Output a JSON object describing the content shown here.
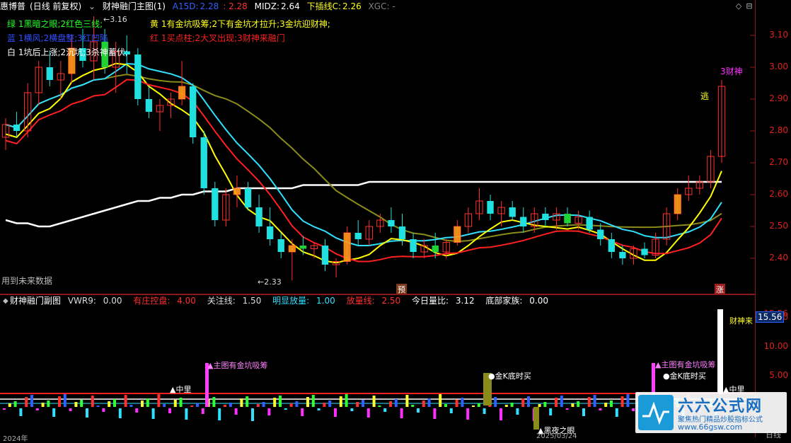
{
  "header": {
    "stock_name": "惠博普",
    "period_mode": "(日线 前复权)",
    "indicator_name": "财神融门主图(1)",
    "a15d_label": "A15D:",
    "a15d_value": "2.28",
    "a15d_value2": ": 2.28",
    "midz_label": "MIDZ:",
    "midz_value": "2.64",
    "xiachaxian_label": "下插线C:",
    "xiachaxian_value": "2.26",
    "xgc_label": "XGC: -"
  },
  "legend": {
    "green": "绿 1黑暗之眼;2红色三线;",
    "yellow": "黄 1有金坑吸筹;2下有金坑才拉升;3金坑迎财神;",
    "blue": "蓝 1横风;2横盘整;3红凹陷",
    "red": "红 1买点柱;2大叉出现;3财神来融门",
    "white": "白 1坑后上涨;2沉坑;3杀神蓄伏;"
  },
  "footer_note": "用到未来数据",
  "annotations": {
    "high_label": "3.16",
    "low_label": "2.33",
    "caishen3": "3财神",
    "tao": "逃",
    "zhang": "涨",
    "yu": "预"
  },
  "sub_header": {
    "name": "财神融门副图",
    "vvr9_label": "VWR9:",
    "vvr9_value": "0.00",
    "youzhuang_label": "有庄控盘:",
    "youzhuang_value": "4.00",
    "guanzhu_label": "关注线:",
    "guanzhu_value": "1.50",
    "mingxian_label": "明显放量:",
    "mingxian_value": "1.00",
    "fangliang_label": "放量线:",
    "fangliang_value": "2.50",
    "jinri_label": "今日量比:",
    "jinri_value": "3.12",
    "dibu_label": "底部家族:",
    "dibu_value": "0.00"
  },
  "sub_annotations": {
    "zhongli1": "中里",
    "zhutu1": "主图有金坑吸筹",
    "jink1": "金K底时买",
    "heiye": "黑夜之眼",
    "zhutu2": "主图有金坑吸筹",
    "jink2": "金K底时买",
    "zhongli2": "中里",
    "caishenlai": "财神来",
    "date_partial": "2025/03/24",
    "bottom_left": "2024年"
  },
  "axis": {
    "main_ticks": [
      "3.10",
      "3.00",
      "2.90",
      "2.80",
      "2.70",
      "2.60",
      "2.50",
      "2.40"
    ],
    "sub_ticks": [
      "15.56",
      "15.00",
      "10.00",
      "5.00"
    ],
    "bottom_label": "日线"
  },
  "logo": {
    "title": "六六公式网",
    "subtitle": "聚焦热门精品炒股指标公式",
    "url": "www.66gsw.com"
  },
  "colors": {
    "up": "#ff3030",
    "down": "#20e0e0",
    "ma_white": "#ffffff",
    "ma_yellow": "#ffff00",
    "ma_olive": "#8b8b1a",
    "ma_cyan": "#30e0ff",
    "ma_red": "#ff2020",
    "band_orange": "#ff9a1a",
    "band_green": "#20d020"
  },
  "chart_data": {
    "type": "candlestick",
    "y_range": [
      2.33,
      3.16
    ],
    "candles": [
      {
        "o": 2.78,
        "h": 2.84,
        "l": 2.74,
        "c": 2.82
      },
      {
        "o": 2.82,
        "h": 2.86,
        "l": 2.78,
        "c": 2.8
      },
      {
        "o": 2.8,
        "h": 2.95,
        "l": 2.78,
        "c": 2.92
      },
      {
        "o": 2.92,
        "h": 3.02,
        "l": 2.88,
        "c": 3.0
      },
      {
        "o": 3.0,
        "h": 3.05,
        "l": 2.94,
        "c": 2.96
      },
      {
        "o": 2.96,
        "h": 3.02,
        "l": 2.9,
        "c": 2.98
      },
      {
        "o": 2.98,
        "h": 3.1,
        "l": 2.95,
        "c": 3.06
      },
      {
        "o": 3.06,
        "h": 3.12,
        "l": 3.0,
        "c": 3.02
      },
      {
        "o": 3.02,
        "h": 3.16,
        "l": 2.96,
        "c": 3.08
      },
      {
        "o": 3.08,
        "h": 3.12,
        "l": 2.98,
        "c": 3.0
      },
      {
        "o": 3.0,
        "h": 3.08,
        "l": 2.92,
        "c": 3.05
      },
      {
        "o": 3.05,
        "h": 3.1,
        "l": 2.98,
        "c": 3.04
      },
      {
        "o": 3.04,
        "h": 3.06,
        "l": 2.88,
        "c": 2.9
      },
      {
        "o": 2.9,
        "h": 2.94,
        "l": 2.84,
        "c": 2.86
      },
      {
        "o": 2.86,
        "h": 2.9,
        "l": 2.8,
        "c": 2.88
      },
      {
        "o": 2.88,
        "h": 2.92,
        "l": 2.84,
        "c": 2.9
      },
      {
        "o": 2.9,
        "h": 3.02,
        "l": 2.88,
        "c": 2.94
      },
      {
        "o": 2.94,
        "h": 2.95,
        "l": 2.76,
        "c": 2.78
      },
      {
        "o": 2.78,
        "h": 2.8,
        "l": 2.6,
        "c": 2.62
      },
      {
        "o": 2.62,
        "h": 2.64,
        "l": 2.5,
        "c": 2.52
      },
      {
        "o": 2.52,
        "h": 2.62,
        "l": 2.5,
        "c": 2.6
      },
      {
        "o": 2.6,
        "h": 2.66,
        "l": 2.56,
        "c": 2.62
      },
      {
        "o": 2.62,
        "h": 2.64,
        "l": 2.55,
        "c": 2.56
      },
      {
        "o": 2.56,
        "h": 2.6,
        "l": 2.48,
        "c": 2.5
      },
      {
        "o": 2.5,
        "h": 2.56,
        "l": 2.44,
        "c": 2.46
      },
      {
        "o": 2.46,
        "h": 2.48,
        "l": 2.4,
        "c": 2.42
      },
      {
        "o": 2.42,
        "h": 2.46,
        "l": 2.33,
        "c": 2.44
      },
      {
        "o": 2.44,
        "h": 2.47,
        "l": 2.41,
        "c": 2.43
      },
      {
        "o": 2.43,
        "h": 2.45,
        "l": 2.4,
        "c": 2.44
      },
      {
        "o": 2.44,
        "h": 2.46,
        "l": 2.36,
        "c": 2.38
      },
      {
        "o": 2.38,
        "h": 2.4,
        "l": 2.34,
        "c": 2.39
      },
      {
        "o": 2.39,
        "h": 2.5,
        "l": 2.38,
        "c": 2.48
      },
      {
        "o": 2.48,
        "h": 2.52,
        "l": 2.44,
        "c": 2.46
      },
      {
        "o": 2.46,
        "h": 2.52,
        "l": 2.44,
        "c": 2.5
      },
      {
        "o": 2.5,
        "h": 2.54,
        "l": 2.48,
        "c": 2.52
      },
      {
        "o": 2.52,
        "h": 2.56,
        "l": 2.48,
        "c": 2.5
      },
      {
        "o": 2.5,
        "h": 2.54,
        "l": 2.44,
        "c": 2.46
      },
      {
        "o": 2.46,
        "h": 2.48,
        "l": 2.4,
        "c": 2.42
      },
      {
        "o": 2.42,
        "h": 2.46,
        "l": 2.4,
        "c": 2.44
      },
      {
        "o": 2.44,
        "h": 2.48,
        "l": 2.4,
        "c": 2.42
      },
      {
        "o": 2.42,
        "h": 2.46,
        "l": 2.4,
        "c": 2.45
      },
      {
        "o": 2.45,
        "h": 2.52,
        "l": 2.44,
        "c": 2.5
      },
      {
        "o": 2.5,
        "h": 2.56,
        "l": 2.48,
        "c": 2.54
      },
      {
        "o": 2.54,
        "h": 2.62,
        "l": 2.52,
        "c": 2.58
      },
      {
        "o": 2.58,
        "h": 2.6,
        "l": 2.52,
        "c": 2.54
      },
      {
        "o": 2.54,
        "h": 2.58,
        "l": 2.5,
        "c": 2.56
      },
      {
        "o": 2.56,
        "h": 2.58,
        "l": 2.52,
        "c": 2.53
      },
      {
        "o": 2.53,
        "h": 2.56,
        "l": 2.48,
        "c": 2.5
      },
      {
        "o": 2.5,
        "h": 2.56,
        "l": 2.48,
        "c": 2.54
      },
      {
        "o": 2.54,
        "h": 2.56,
        "l": 2.5,
        "c": 2.52
      },
      {
        "o": 2.52,
        "h": 2.56,
        "l": 2.49,
        "c": 2.54
      },
      {
        "o": 2.54,
        "h": 2.56,
        "l": 2.5,
        "c": 2.51
      },
      {
        "o": 2.51,
        "h": 2.55,
        "l": 2.49,
        "c": 2.53
      },
      {
        "o": 2.53,
        "h": 2.55,
        "l": 2.48,
        "c": 2.49
      },
      {
        "o": 2.49,
        "h": 2.51,
        "l": 2.44,
        "c": 2.46
      },
      {
        "o": 2.46,
        "h": 2.48,
        "l": 2.4,
        "c": 2.42
      },
      {
        "o": 2.42,
        "h": 2.44,
        "l": 2.38,
        "c": 2.4
      },
      {
        "o": 2.4,
        "h": 2.44,
        "l": 2.38,
        "c": 2.43
      },
      {
        "o": 2.43,
        "h": 2.45,
        "l": 2.4,
        "c": 2.41
      },
      {
        "o": 2.41,
        "h": 2.48,
        "l": 2.4,
        "c": 2.46
      },
      {
        "o": 2.46,
        "h": 2.56,
        "l": 2.44,
        "c": 2.54
      },
      {
        "o": 2.54,
        "h": 2.62,
        "l": 2.52,
        "c": 2.6
      },
      {
        "o": 2.6,
        "h": 2.66,
        "l": 2.58,
        "c": 2.62
      },
      {
        "o": 2.62,
        "h": 2.66,
        "l": 2.6,
        "c": 2.64
      },
      {
        "o": 2.64,
        "h": 2.74,
        "l": 2.62,
        "c": 2.72
      },
      {
        "o": 2.72,
        "h": 2.96,
        "l": 2.7,
        "c": 2.94
      }
    ],
    "series": [
      {
        "name": "MIDZ",
        "values": [
          2.52,
          2.51,
          2.51,
          2.5,
          2.5,
          2.51,
          2.52,
          2.53,
          2.54,
          2.55,
          2.56,
          2.57,
          2.58,
          2.58,
          2.59,
          2.59,
          2.6,
          2.6,
          2.61,
          2.61,
          2.61,
          2.62,
          2.62,
          2.62,
          2.62,
          2.62,
          2.62,
          2.63,
          2.63,
          2.63,
          2.63,
          2.63,
          2.63,
          2.64,
          2.64,
          2.64,
          2.64,
          2.64,
          2.64,
          2.64,
          2.64,
          2.64,
          2.64,
          2.64,
          2.64,
          2.64,
          2.64,
          2.64,
          2.64,
          2.64,
          2.64,
          2.64,
          2.64,
          2.64,
          2.64,
          2.64,
          2.64,
          2.64,
          2.64,
          2.64,
          2.64,
          2.64,
          2.64,
          2.64,
          2.64,
          2.64
        ]
      }
    ]
  }
}
